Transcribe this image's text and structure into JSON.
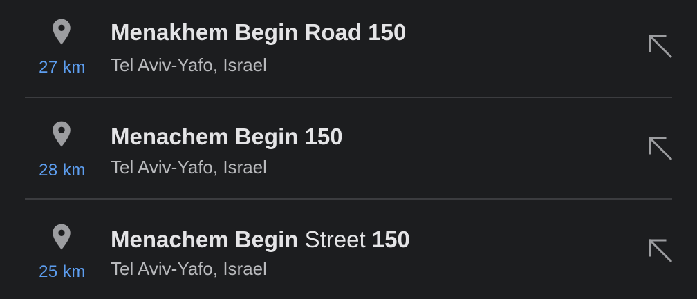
{
  "suggestions": [
    {
      "title_bold": "Menakhem Begin Road 150",
      "title_normal": "",
      "subtitle": "Tel Aviv-Yafo, Israel",
      "distance": "27 km",
      "icon": "location-pin-icon",
      "action_icon": "arrow-up-left-icon"
    },
    {
      "title_bold": "Menachem Begin 150",
      "title_normal": "",
      "subtitle": "Tel Aviv-Yafo, Israel",
      "distance": "28 km",
      "icon": "location-pin-icon",
      "action_icon": "arrow-up-left-icon"
    },
    {
      "title_bold": "Menachem Begin",
      "title_normal": " Street",
      "title_bold_tail": " 150",
      "subtitle": "Tel Aviv-Yafo, Israel",
      "distance": "25 km",
      "icon": "location-pin-icon",
      "action_icon": "arrow-up-left-icon"
    }
  ],
  "colors": {
    "background": "#1c1d1f",
    "title": "#e4e4e6",
    "subtitle": "#b9babd",
    "distance": "#5d9ef0",
    "icon": "#9c9da0",
    "divider": "#3b3c3f"
  }
}
